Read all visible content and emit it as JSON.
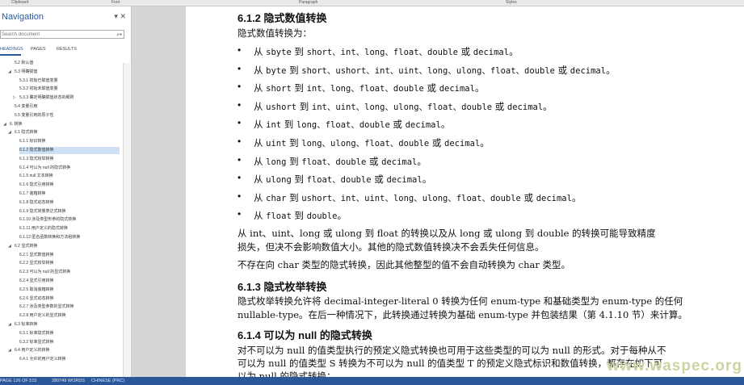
{
  "ribbon": {
    "clipboard": "Clipboard",
    "font": "Font",
    "paragraph": "Paragraph",
    "styles": "Styles"
  },
  "nav": {
    "title": "Navigation",
    "search_placeholder": "Search document",
    "tabs": [
      "HEADINGS",
      "PAGES",
      "RESULTS"
    ],
    "items": [
      {
        "label": "5.2 默认值",
        "indent": 1
      },
      {
        "label": "5.3 明确赋值",
        "indent": 1,
        "toggle": "◢"
      },
      {
        "label": "5.3.1 初始已赋值变量",
        "indent": 2
      },
      {
        "label": "5.3.2 初始未赋值变量",
        "indent": 2
      },
      {
        "label": "5.3.3 确定明确赋值状态的细则",
        "indent": 2,
        "toggle": "▷"
      },
      {
        "label": "5.4 变量引用",
        "indent": 1
      },
      {
        "label": "5.5 变量引用的原子性",
        "indent": 1
      },
      {
        "label": "6. 转换",
        "indent": 0,
        "toggle": "◢"
      },
      {
        "label": "6.1 隐式转换",
        "indent": 1,
        "toggle": "◢"
      },
      {
        "label": "6.1.1 标识转换",
        "indent": 2
      },
      {
        "label": "6.1.2 隐式数值转换",
        "indent": 2,
        "selected": true
      },
      {
        "label": "6.1.3 隐式枚举转换",
        "indent": 2
      },
      {
        "label": "6.1.4 可以为 null 的隐式转换",
        "indent": 2
      },
      {
        "label": "6.1.5 null 文本转换",
        "indent": 2
      },
      {
        "label": "6.1.6 隐式引用转换",
        "indent": 2
      },
      {
        "label": "6.1.7 装箱转换",
        "indent": 2
      },
      {
        "label": "6.1.8 隐式动态转换",
        "indent": 2
      },
      {
        "label": "6.1.9 隐式常量表达式转换",
        "indent": 2
      },
      {
        "label": "6.1.10 涉及类型形参的隐式转换",
        "indent": 2
      },
      {
        "label": "6.1.11 用户定义的隐式转换",
        "indent": 2
      },
      {
        "label": "6.1.12 匿名函数转换和方法组转换",
        "indent": 2
      },
      {
        "label": "6.2 显式转换",
        "indent": 1,
        "toggle": "◢"
      },
      {
        "label": "6.2.1 显式数值转换",
        "indent": 2
      },
      {
        "label": "6.2.2 显式枚举转换",
        "indent": 2
      },
      {
        "label": "6.2.3 可以为 null 的显式转换",
        "indent": 2
      },
      {
        "label": "6.2.4 显式引用转换",
        "indent": 2
      },
      {
        "label": "6.2.5 取消装箱转换",
        "indent": 2
      },
      {
        "label": "6.2.6 显式动态转换",
        "indent": 2
      },
      {
        "label": "6.2.7 涉及类型参数的显式转换",
        "indent": 2
      },
      {
        "label": "6.2.8 用户定义的显式转换",
        "indent": 2
      },
      {
        "label": "6.3 标准转换",
        "indent": 1,
        "toggle": "◢"
      },
      {
        "label": "6.3.1 标准隐式转换",
        "indent": 2
      },
      {
        "label": "6.3.2 标准显式转换",
        "indent": 2
      },
      {
        "label": "6.4 用户定义的转换",
        "indent": 1,
        "toggle": "◢"
      },
      {
        "label": "6.4.1 允许的用户定义转换",
        "indent": 2
      }
    ]
  },
  "doc": {
    "h612": "6.1.2 隐式数值转换",
    "intro": "隐式数值转换为：",
    "bullets": [
      {
        "from": "sbyte",
        "to": "short、int、long、float、double",
        "or": "decimal"
      },
      {
        "from": "byte",
        "to": "short、ushort、int、uint、long、ulong、float、double",
        "or": "decimal"
      },
      {
        "from": "short",
        "to": "int、long、float、double",
        "or": "decimal"
      },
      {
        "from": "ushort",
        "to": "int、uint、long、ulong、float、double",
        "or": "decimal"
      },
      {
        "from": "int",
        "to": "long、float、double",
        "or": "decimal"
      },
      {
        "from": "uint",
        "to": "long、ulong、float、double",
        "or": "decimal"
      },
      {
        "from": "long",
        "to": "float、double",
        "or": "decimal"
      },
      {
        "from": "ulong",
        "to": "float、double",
        "or": "decimal"
      },
      {
        "from": "char",
        "to": "ushort、int、uint、long、ulong、float、double",
        "or": "decimal"
      },
      {
        "from": "float",
        "to": "double",
        "or": ""
      }
    ],
    "word_to": "到",
    "word_from": "从",
    "word_or": "或",
    "para1_l1": "从 int、uint、long 或 ulong 到 float 的转换以及从 long 或 ulong 到 double 的转换可能导致精度",
    "para1_l2": "损失，但决不会影响数值大小。其他的隐式数值转换决不会丢失任何信息。",
    "para2": "不存在向 char 类型的隐式转换，因此其他整型的值不会自动转换为 char 类型。",
    "h613": "6.1.3 隐式枚举转换",
    "para3_l1": "隐式枚举转换允许将 decimal-integer-literal 0 转换为任何 enum-type 和基础类型为 enum-type 的任何",
    "para3_l2": "nullable-type。在后一种情况下，此转换通过转换为基础 enum-type 并包装结果（第 4.1.10 节）来计算。",
    "h614": "6.1.4 可以为 null 的隐式转换",
    "para4_l1": "对不可以为 null 的值类型执行的预定义隐式转换也可用于这些类型的可以为 null 的形式。对于每种从不",
    "para4_l2": "可以为 null 的值类型 S 转换为不可以为 null 的值类型 T 的预定义隐式标识和数值转换，都存在如下可",
    "para4_l3": "以为 null 的隐式转换："
  },
  "status": {
    "page": "PAGE 126 OF 515",
    "words": "280749 WORDS",
    "lang": "CHINESE (PRC)"
  },
  "watermark": "www.waspec.org"
}
